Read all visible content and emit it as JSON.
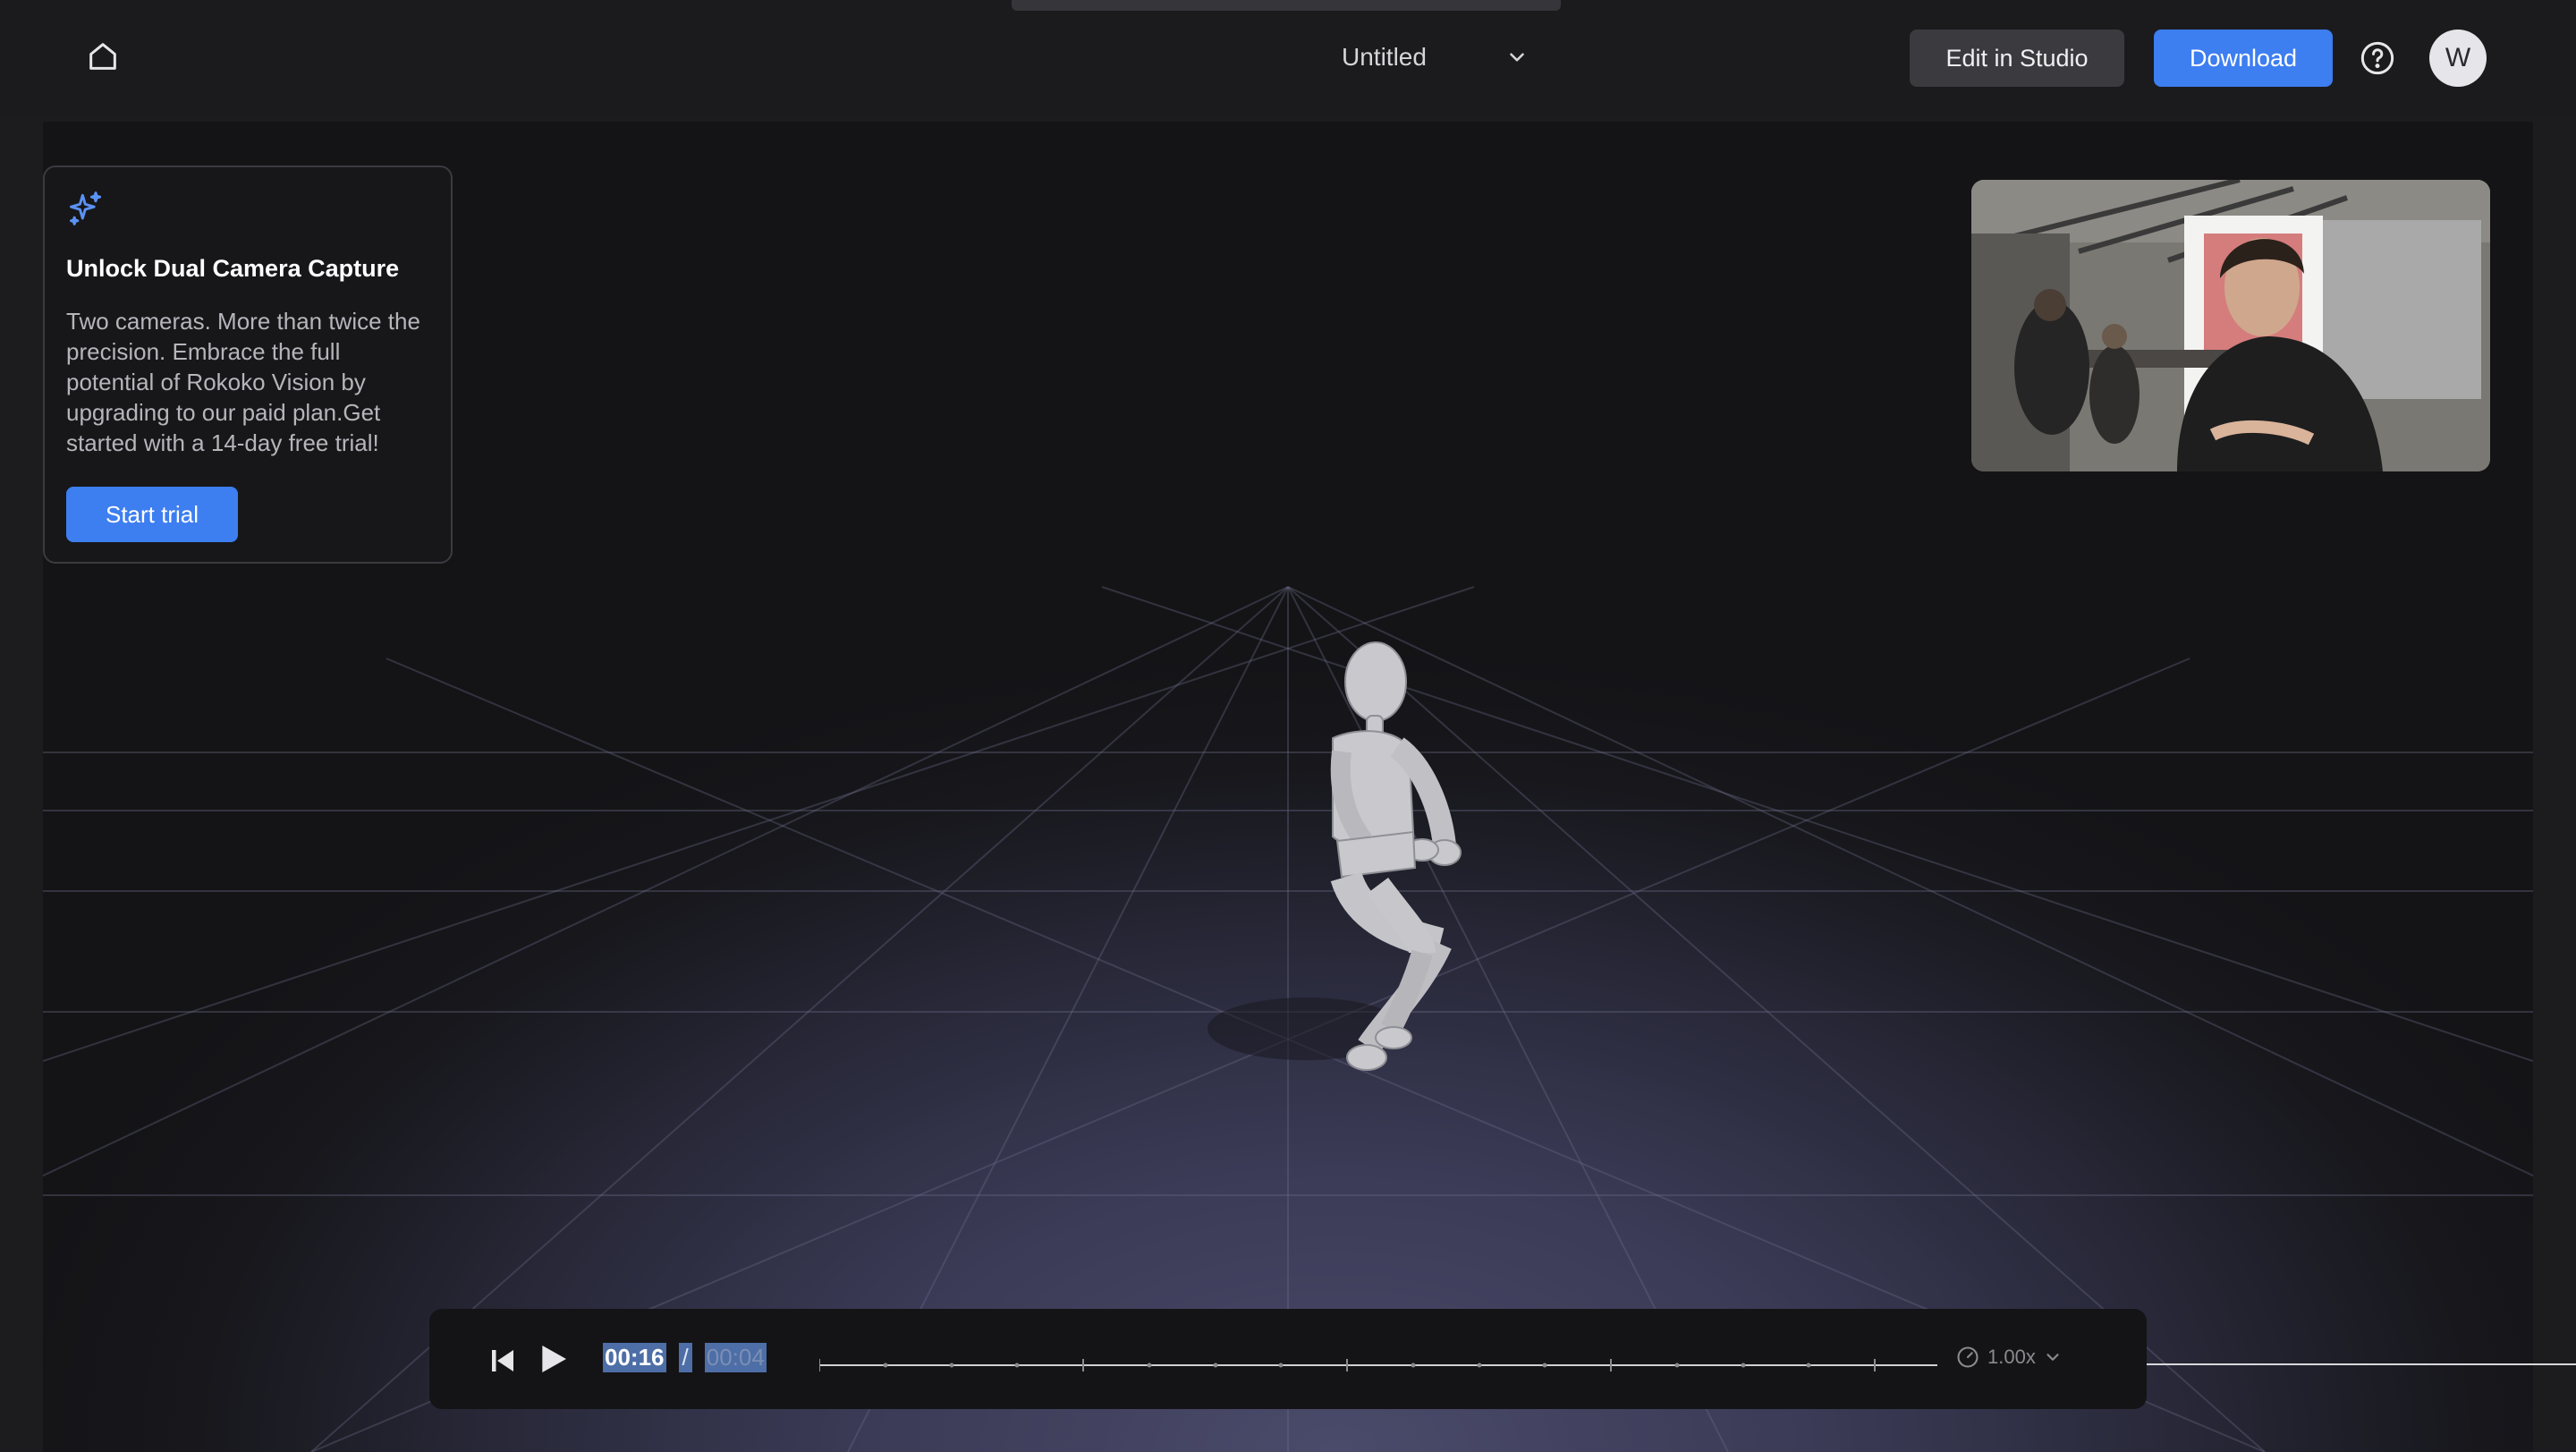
{
  "header": {
    "project_title": "Untitled",
    "edit_label": "Edit in Studio",
    "download_label": "Download",
    "avatar_initial": "W"
  },
  "promo": {
    "title": "Unlock Dual Camera Capture",
    "body": "Two cameras. More than twice the precision. Embrace the full potential of Rokoko Vision by upgrading to our paid plan.Get started with a 14-day free trial!",
    "cta_label": "Start trial"
  },
  "player": {
    "current_time": "00:16",
    "separator": "/",
    "duration": "00:04",
    "speed": "1.00x"
  },
  "colors": {
    "accent": "#3d7ef0",
    "background": "#1c1c1f",
    "secondary_button": "#3a3a3f"
  },
  "icons": {
    "home": "home-icon",
    "title_dropdown": "chevron-down-icon",
    "help": "help-circle-icon",
    "promo": "sparkle-icon",
    "restart": "skip-back-icon",
    "play": "play-icon",
    "speed": "speedometer-icon",
    "speed_dropdown": "chevron-down-icon"
  }
}
